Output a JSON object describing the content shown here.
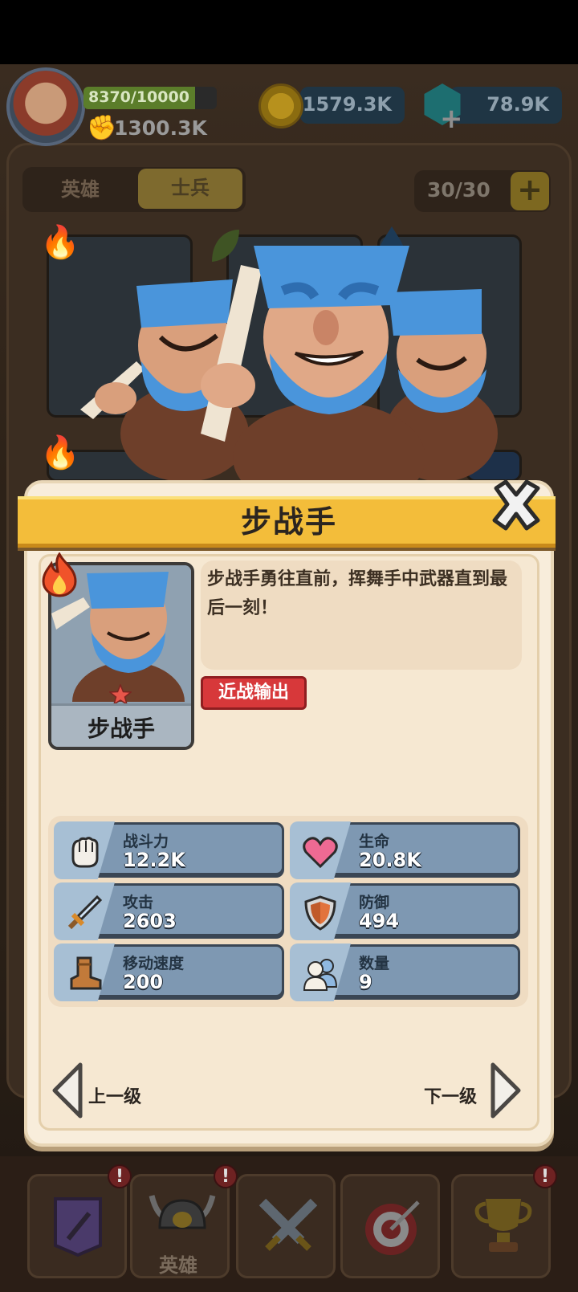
{
  "header": {
    "xp_text": "8370/10000",
    "xp_fraction": 0.837,
    "power": "1300.3K",
    "coins": "1579.3K",
    "gems": "78.9K"
  },
  "tabs": {
    "heroes": "英雄",
    "soldiers": "士兵",
    "active": "soldiers"
  },
  "capacity": {
    "text": "30/30"
  },
  "modal": {
    "title": "步战手",
    "unit_name": "步战手",
    "description": "步战手勇往直前，挥舞手中武器直到最后一刻！",
    "tag": "近战输出",
    "stats": [
      {
        "label": "战斗力",
        "value": "12.2K",
        "icon": "fist-icon"
      },
      {
        "label": "生命",
        "value": "20.8K",
        "icon": "heart-icon"
      },
      {
        "label": "攻击",
        "value": "2603",
        "icon": "sword-icon"
      },
      {
        "label": "防御",
        "value": "494",
        "icon": "shield-icon"
      },
      {
        "label": "移动速度",
        "value": "200",
        "icon": "boot-icon"
      },
      {
        "label": "数量",
        "value": "9",
        "icon": "people-icon"
      }
    ],
    "prev_label": "上一级",
    "next_label": "下一级"
  },
  "bottom_nav": {
    "hero_label": "英雄",
    "badges": [
      "!",
      "!",
      "!"
    ]
  },
  "colors": {
    "title_bar": "#f3bd3a",
    "tag": "#d7383a",
    "stat_bg": "#7e98b2"
  }
}
